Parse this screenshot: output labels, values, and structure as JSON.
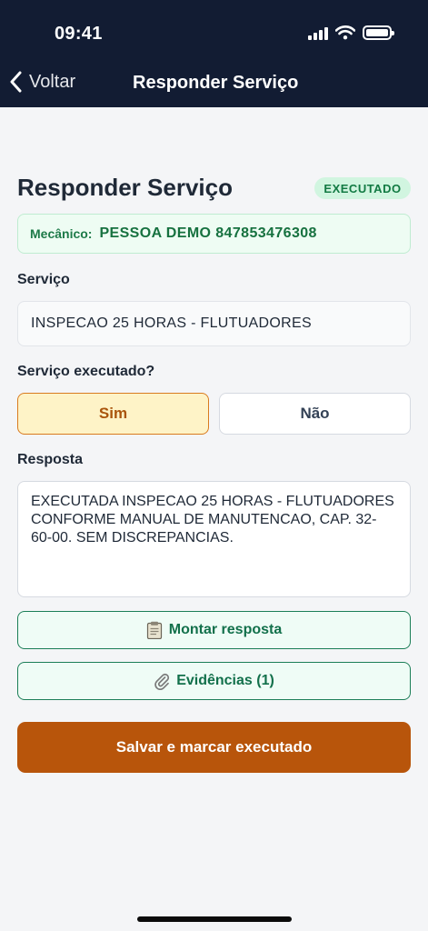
{
  "status_bar": {
    "time": "09:41"
  },
  "nav": {
    "back_label": "Voltar",
    "title": "Responder Serviço"
  },
  "page": {
    "heading": "Responder Serviço",
    "status_badge": "EXECUTADO",
    "mechanic_label": "Mecânico:",
    "mechanic_name": "PESSOA DEMO 847853476308"
  },
  "service": {
    "label": "Serviço",
    "value": "INSPECAO 25 HORAS - FLUTUADORES"
  },
  "executed": {
    "label": "Serviço executado?",
    "yes": "Sim",
    "no": "Não",
    "selected": "Sim"
  },
  "response": {
    "label": "Resposta",
    "value": "EXECUTADA INSPECAO 25 HORAS - FLUTUADORES CONFORME MANUAL DE MANUTENCAO, CAP. 32-60-00. SEM DISCREPANCIAS."
  },
  "actions": {
    "build_response": "Montar resposta",
    "build_response_icon": "clipboard-icon",
    "evidence": "Evidências (1)",
    "evidence_icon": "paperclip-icon",
    "save": "Salvar e marcar executado"
  },
  "colors": {
    "header_bg": "#121c33",
    "primary": "#b8550b",
    "success_green": "#12704b",
    "selected_bg": "#fef3c7"
  }
}
